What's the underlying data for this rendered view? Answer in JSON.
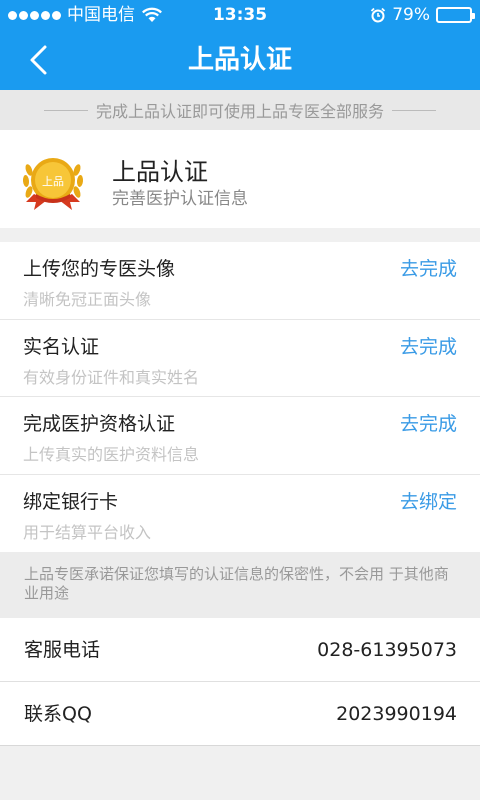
{
  "status_bar": {
    "carrier": "中国电信",
    "time": "13:35",
    "battery_text": "79%",
    "battery_level": 0.79
  },
  "nav": {
    "title": "上品认证",
    "back_icon": "chevron-left-icon"
  },
  "notice": "完成上品认证即可使用上品专医全部服务",
  "cert": {
    "title": "上品认证",
    "subtitle": "完善医护认证信息",
    "badge_text": "上品",
    "icon": "medal-icon"
  },
  "tasks": [
    {
      "title": "上传您的专医头像",
      "subtitle": "清晰免冠正面头像",
      "action": "去完成"
    },
    {
      "title": "实名认证",
      "subtitle": "有效身份证件和真实姓名",
      "action": "去完成"
    },
    {
      "title": "完成医护资格认证",
      "subtitle": "上传真实的医护资料信息",
      "action": "去完成"
    },
    {
      "title": "绑定银行卡",
      "subtitle": "用于结算平台收入",
      "action": "去绑定"
    }
  ],
  "privacy_note": "上品专医承诺保证您填写的认证信息的保密性，不会用 于其他商业用途",
  "contact": [
    {
      "label": "客服电话",
      "value": "028-61395073"
    },
    {
      "label": "联系QQ",
      "value": "2023990194"
    }
  ],
  "colors": {
    "primary": "#1a9bf0",
    "action": "#3a9be6",
    "medal_gold": "#f2b417"
  }
}
